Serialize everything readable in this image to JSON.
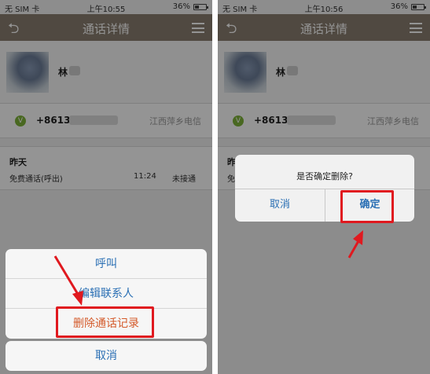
{
  "status_bar": {
    "carrier": "无 SIM 卡",
    "left_time": "上午10:55",
    "right_time": "上午10:56",
    "battery": "36%"
  },
  "navbar": {
    "title": "通话详情",
    "back_icon": "back-arrow-icon",
    "menu_icon": "menu-icon"
  },
  "contact": {
    "name": "林"
  },
  "phone_info": {
    "badge": "V",
    "number": "+8613",
    "location": "江西萍乡电信"
  },
  "call_record": {
    "day": "昨天",
    "type": "免费通话(呼出)",
    "time": "11:24",
    "status": "未接通"
  },
  "action_sheet": {
    "call": "呼叫",
    "edit_contact": "编辑联系人",
    "delete_record": "删除通话记录",
    "cancel": "取消"
  },
  "alert": {
    "message": "是否确定删除?",
    "cancel": "取消",
    "confirm": "确定"
  },
  "colors": {
    "navbar": "#8a7f70",
    "highlight": "#e0191f",
    "action_text": "#2a6fb4",
    "danger_text": "#d45a2a",
    "badge_green": "#7fb33a"
  }
}
